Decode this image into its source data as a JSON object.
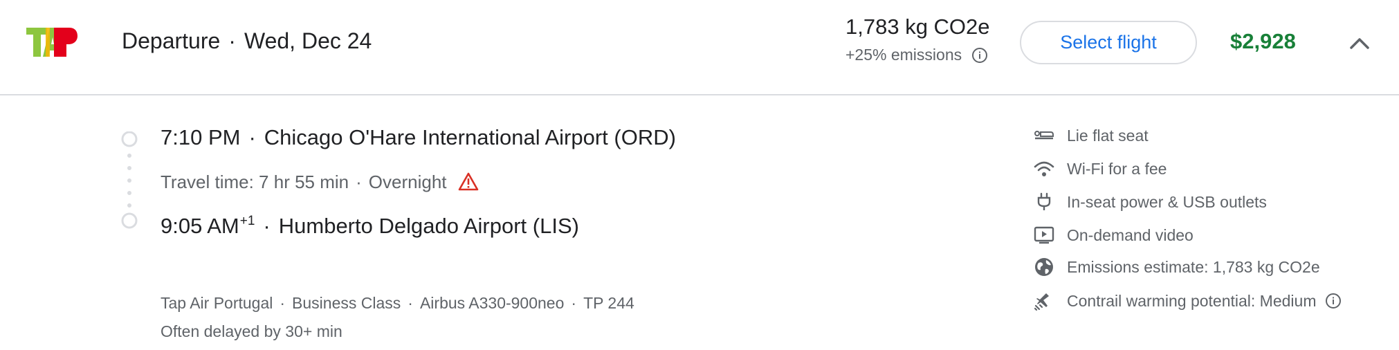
{
  "header": {
    "airline_logo": "tap-air-portugal-logo",
    "direction": "Departure",
    "separator": "·",
    "date": "Wed, Dec 24",
    "emissions": "1,783 kg CO2e",
    "emissions_delta": "+25% emissions",
    "select_label": "Select flight",
    "price": "$2,928"
  },
  "itinerary": {
    "departure_time": "7:10 PM",
    "departure_airport": "Chicago O'Hare International Airport (ORD)",
    "travel_time": "Travel time: 7 hr 55 min",
    "overnight": "Overnight",
    "arrival_time": "9:05 AM",
    "arrival_day_offset": "+1",
    "arrival_airport": "Humberto Delgado Airport (LIS)"
  },
  "details": {
    "airline": "Tap Air Portugal",
    "cabin": "Business Class",
    "aircraft": "Airbus A330-900neo",
    "flight_number": "TP 244",
    "delay_note": "Often delayed by 30+ min"
  },
  "amenities": [
    {
      "icon": "lie-flat-seat-icon",
      "label": "Lie flat seat"
    },
    {
      "icon": "wifi-icon",
      "label": "Wi-Fi for a fee"
    },
    {
      "icon": "power-plug-icon",
      "label": "In-seat power & USB outlets"
    },
    {
      "icon": "video-icon",
      "label": "On-demand video"
    },
    {
      "icon": "globe-icon",
      "label": "Emissions estimate: 1,783 kg CO2e"
    },
    {
      "icon": "contrail-icon",
      "label": "Contrail warming potential: Medium"
    }
  ],
  "colors": {
    "price": "#188038",
    "select_button_text": "#1a73e8",
    "warning": "#d93025",
    "secondary_text": "#5f6368"
  }
}
